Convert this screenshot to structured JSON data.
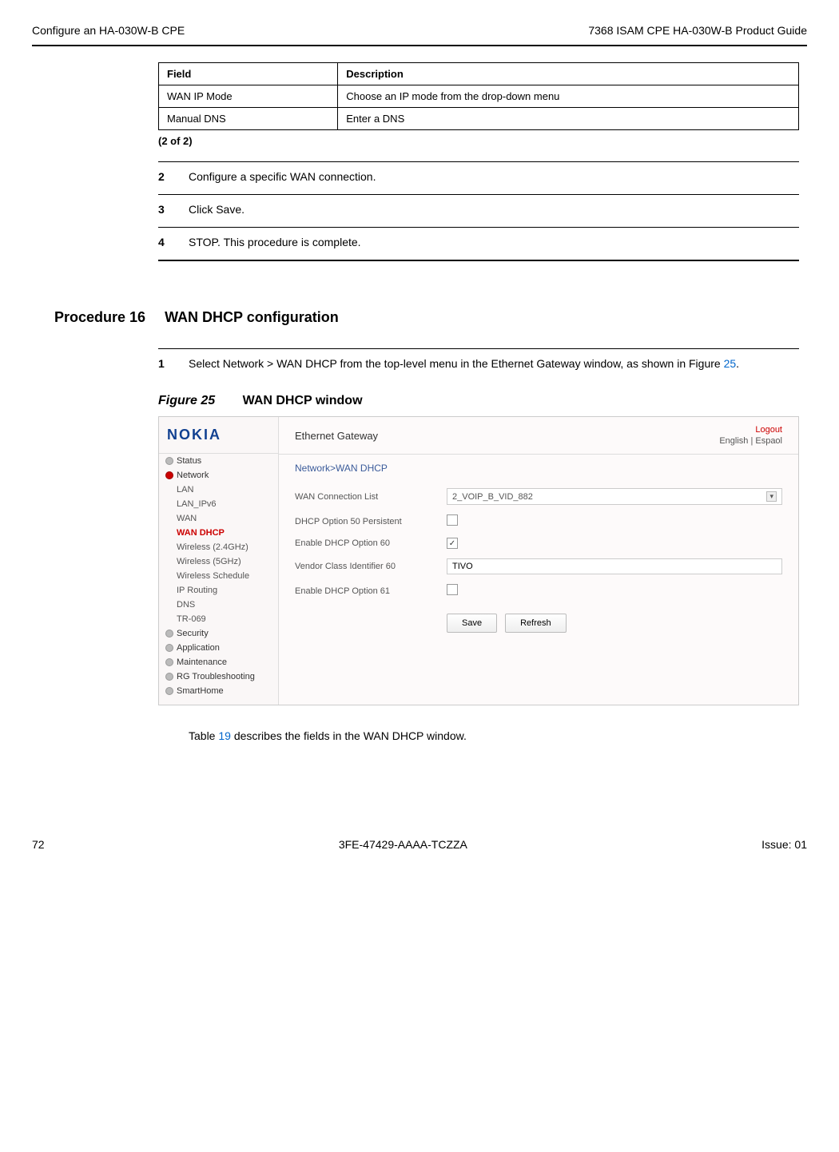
{
  "header": {
    "left": "Configure an HA-030W-B CPE",
    "right": "7368 ISAM CPE HA-030W-B Product Guide"
  },
  "table": {
    "head": {
      "c1": "Field",
      "c2": "Description"
    },
    "rows": [
      {
        "c1": "WAN IP Mode",
        "c2": "Choose an IP mode from the drop-down menu"
      },
      {
        "c1": "Manual DNS",
        "c2": "Enter a DNS"
      }
    ],
    "note": "(2 of 2)"
  },
  "steps": {
    "s2": {
      "n": "2",
      "t": "Configure a specific WAN connection."
    },
    "s3": {
      "n": "3",
      "t": "Click Save."
    },
    "s4": {
      "n": "4",
      "t": "STOP. This procedure is complete."
    }
  },
  "procedure": {
    "num": "Procedure 16",
    "title": "WAN DHCP configuration"
  },
  "step1": {
    "n": "1",
    "pre": "Select Network > WAN DHCP from the top-level menu in the Ethernet Gateway window, as shown in Figure ",
    "link": "25",
    "post": "."
  },
  "figure": {
    "num": "Figure 25",
    "title": "WAN DHCP window"
  },
  "shot": {
    "logo": "NOKIA",
    "sidebar": {
      "status": "Status",
      "network": "Network",
      "lan": "LAN",
      "lanipv6": "LAN_IPv6",
      "wan": "WAN",
      "wandhcp": "WAN DHCP",
      "w24": "Wireless (2.4GHz)",
      "w5": "Wireless (5GHz)",
      "wsched": "Wireless Schedule",
      "iprouting": "IP Routing",
      "dns": "DNS",
      "tr069": "TR-069",
      "security": "Security",
      "application": "Application",
      "maintenance": "Maintenance",
      "rg": "RG Troubleshooting",
      "smarthome": "SmartHome"
    },
    "main": {
      "title": "Ethernet Gateway",
      "logout": "Logout",
      "langs": "English | Espaol",
      "crumb": "Network>WAN DHCP",
      "labels": {
        "conn": "WAN Connection List",
        "opt50": "DHCP Option 50 Persistent",
        "opt60": "Enable DHCP Option 60",
        "vci": "Vendor Class Identifier 60",
        "opt61": "Enable DHCP Option 61"
      },
      "values": {
        "conn": "2_VOIP_B_VID_882",
        "vci": "TIVO",
        "opt60check": "✓"
      },
      "buttons": {
        "save": "Save",
        "refresh": "Refresh"
      }
    }
  },
  "after": {
    "pre": "Table ",
    "link": "19",
    "post": " describes the fields in the WAN DHCP window."
  },
  "footer": {
    "page": "72",
    "doc": "3FE-47429-AAAA-TCZZA",
    "issue": "Issue: 01"
  }
}
